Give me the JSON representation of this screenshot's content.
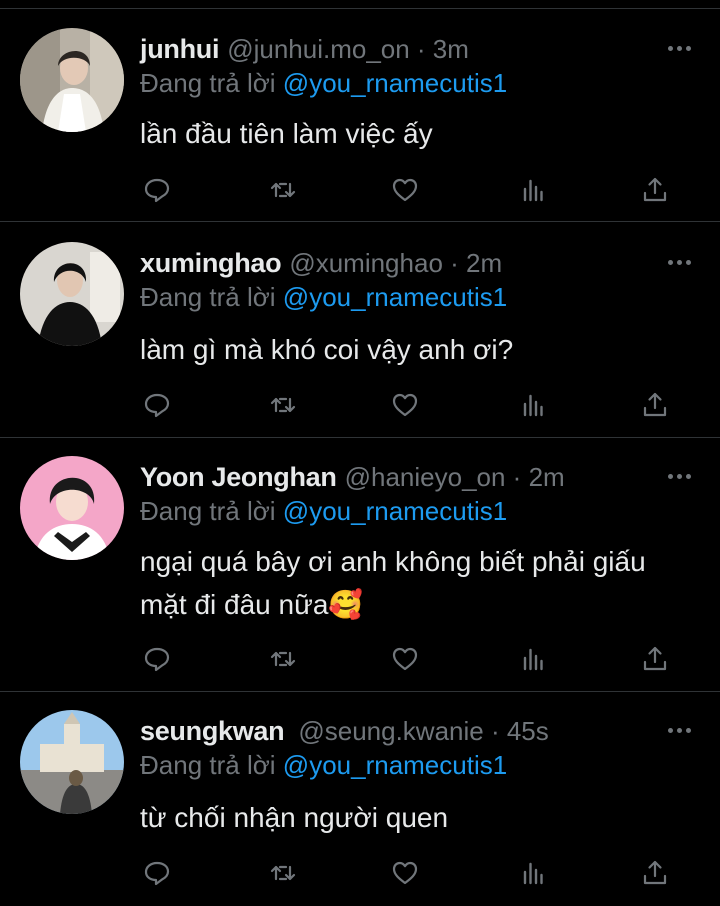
{
  "theme": {
    "background": "#000000",
    "text": "#e7e9ea",
    "muted": "#71767b",
    "link": "#1d9bf0",
    "divider": "#2f3336"
  },
  "tweets": [
    {
      "display_name": "junhui",
      "meta": "@junhui.mo_on · 3m",
      "reply_prefix": "Đang trả lời",
      "reply_handle": "@you_rnamecutis1",
      "text": "lần đầu tiên làm việc ấy",
      "avatar_palette": [
        "#c9c2b6",
        "#8a8378",
        "#f1efe9",
        "#2b2622"
      ]
    },
    {
      "display_name": "xuminghao",
      "meta": "@xuminghao · 2m",
      "reply_prefix": "Đang trả lời",
      "reply_handle": "@you_rnamecutis1",
      "text": "làm gì mà khó coi vậy anh ơi?",
      "avatar_palette": [
        "#d9d6d0",
        "#111111",
        "#6b6660",
        "#e8e4dc"
      ]
    },
    {
      "display_name": "Yoon Jeonghan",
      "meta": "@hanieyo_on · 2m",
      "reply_prefix": "Đang trả lời",
      "reply_handle": "@you_rnamecutis1",
      "text": "ngại quá bây ơi anh không biết phải giấu mặt đi đâu nữa🥰",
      "avatar_palette": [
        "#f4a6c8",
        "#1a1a1a",
        "#f6dcd0",
        "#ffffff"
      ]
    },
    {
      "display_name": "seungkwan",
      "meta": "@seung.kwanie · 45s",
      "reply_prefix": "Đang trả lời",
      "reply_handle": "@you_rnamecutis1",
      "text": "từ chối nhận người quen",
      "avatar_palette": [
        "#9cc8ec",
        "#e9e2d3",
        "#3a3a3a",
        "#6a5a45"
      ]
    }
  ],
  "action_icons": [
    "reply-icon",
    "retweet-icon",
    "like-icon",
    "views-icon",
    "share-icon"
  ]
}
